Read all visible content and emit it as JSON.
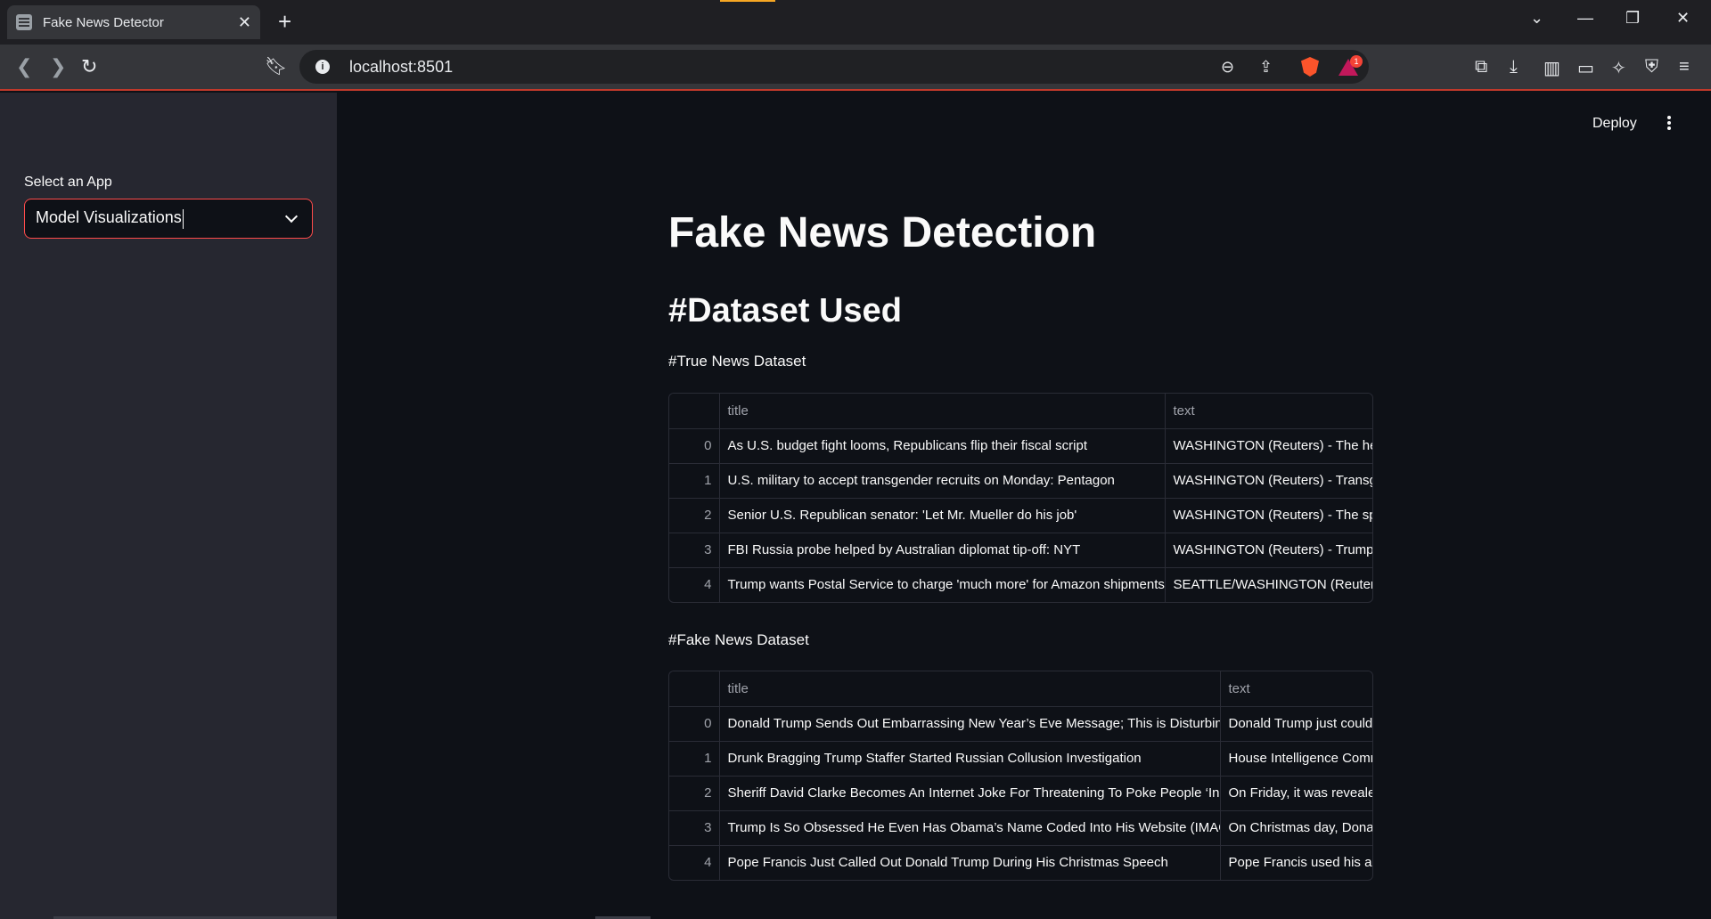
{
  "browser": {
    "tab_title": "Fake News Detector",
    "url": "localhost:8501",
    "rewards_badge": "1"
  },
  "sidebar": {
    "select_label": "Select an App",
    "select_value": "Model Visualizations"
  },
  "header": {
    "deploy_label": "Deploy"
  },
  "main": {
    "title": "Fake News Detection",
    "section_title": "#Dataset Used",
    "true_caption": "#True News Dataset",
    "fake_caption": "#Fake News Dataset",
    "true_table": {
      "columns": [
        "",
        "title",
        "text"
      ],
      "rows": [
        {
          "index": "0",
          "title": "As U.S. budget fight looms, Republicans flip their fiscal script",
          "text": "WASHINGTON (Reuters) - The head"
        },
        {
          "index": "1",
          "title": "U.S. military to accept transgender recruits on Monday: Pentagon",
          "text": "WASHINGTON (Reuters) - Transgen"
        },
        {
          "index": "2",
          "title": "Senior U.S. Republican senator: 'Let Mr. Mueller do his job'",
          "text": "WASHINGTON (Reuters) - The spec"
        },
        {
          "index": "3",
          "title": "FBI Russia probe helped by Australian diplomat tip-off: NYT",
          "text": "WASHINGTON (Reuters) - Trump ca"
        },
        {
          "index": "4",
          "title": "Trump wants Postal Service to charge 'much more' for Amazon shipments",
          "text": "SEATTLE/WASHINGTON (Reuters) -"
        }
      ]
    },
    "fake_table": {
      "columns": [
        "",
        "title",
        "text"
      ],
      "rows": [
        {
          "index": "0",
          "title": "Donald Trump Sends Out Embarrassing New Year’s Eve Message; This is Disturbing",
          "text": "Donald Trump just could"
        },
        {
          "index": "1",
          "title": "Drunk Bragging Trump Staffer Started Russian Collusion Investigation",
          "text": "House Intelligence Comm"
        },
        {
          "index": "2",
          "title": "Sheriff David Clarke Becomes An Internet Joke For Threatening To Poke People ‘In Th",
          "text": "On Friday, it was reveale"
        },
        {
          "index": "3",
          "title": "Trump Is So Obsessed He Even Has Obama’s Name Coded Into His Website (IMAGES)",
          "text": "On Christmas day, Donal"
        },
        {
          "index": "4",
          "title": "Pope Francis Just Called Out Donald Trump During His Christmas Speech",
          "text": "Pope Francis used his an"
        }
      ]
    }
  }
}
